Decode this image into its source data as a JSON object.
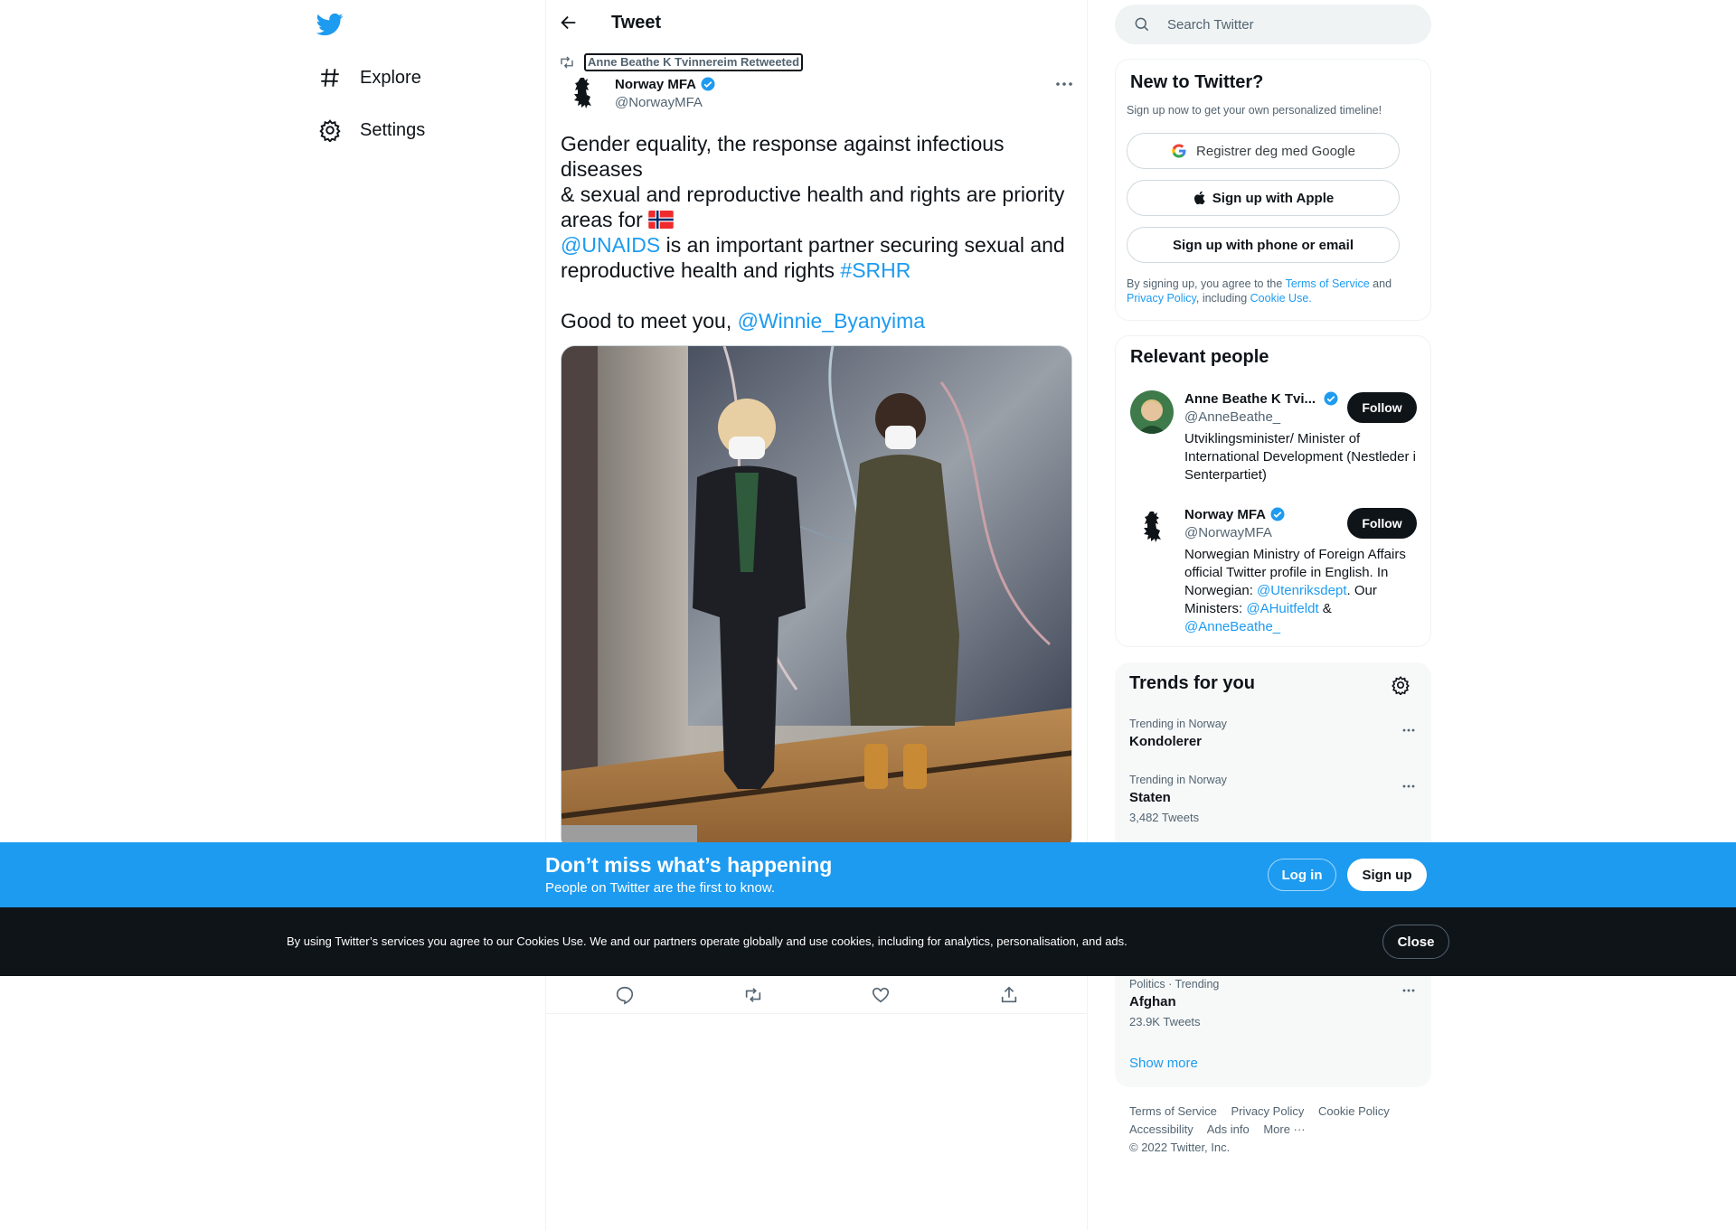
{
  "nav": {
    "explore_label": "Explore",
    "settings_label": "Settings"
  },
  "header": {
    "title": "Tweet"
  },
  "tweet": {
    "retweeted_by": "Anne Beathe K Tvinnereim Retweeted",
    "author_name": "Norway MFA",
    "author_handle": "@NorwayMFA",
    "line1": "Gender equality, the response against infectious diseases",
    "line2": "& sexual and reproductive health and rights are priority areas for",
    "mention_unaids": "@UNAIDS",
    "line3": " is an important partner securing sexual and reproductive health and rights",
    "hashtag": "#SRHR",
    "line4": "Good to meet you,",
    "mention_winnie": "@Winnie_Byanyima"
  },
  "search": {
    "placeholder": "Search Twitter"
  },
  "new_to_twitter": {
    "title": "New to Twitter?",
    "subtitle": "Sign up now to get your own personalized timeline!",
    "google_label": "Registrer deg med Google",
    "apple_label": "Sign up with Apple",
    "phone_label": "Sign up with phone or email",
    "terms_prefix": "By signing up, you agree to the",
    "terms_link": "Terms of Service",
    "terms_and": "and",
    "privacy_link": "Privacy Policy",
    "including": ", including",
    "cookie_link": "Cookie Use."
  },
  "relevant_people": {
    "title": "Relevant people",
    "people": [
      {
        "name": "Anne Beathe K Tvi...",
        "handle": "@AnneBeathe_",
        "bio": "Utviklingsminister/ Minister of International Development (Nestleder i Senterpartiet)",
        "follow_label": "Follow"
      },
      {
        "name": "Norway MFA",
        "handle": "@NorwayMFA",
        "bio_part1": "Norwegian Ministry of Foreign Affairs official Twitter profile in English. In Norwegian:",
        "bio_link1": "@Utenriksdept",
        "bio_part2": ". Our Ministers:",
        "bio_link2": "@AHuitfeldt",
        "bio_part3": " &",
        "bio_link3": "@AnneBeathe_",
        "follow_label": "Follow"
      }
    ]
  },
  "trends": {
    "title": "Trends for you",
    "items": [
      {
        "meta": "Trending in Norway",
        "name": "Kondolerer",
        "count": ""
      },
      {
        "meta": "Trending in Norway",
        "name": "Staten",
        "count": "3,482 Tweets"
      },
      {
        "meta": "Politics · Trending",
        "name": "Afghan",
        "count": "23.9K Tweets"
      }
    ],
    "show_more": "Show more"
  },
  "footer": {
    "links": [
      "Terms of Service",
      "Privacy Policy",
      "Cookie Policy",
      "Accessibility",
      "Ads info",
      "More ···"
    ],
    "copyright": "© 2022 Twitter, Inc."
  },
  "banner": {
    "title": "Don’t miss what’s happening",
    "subtitle": "People on Twitter are the first to know.",
    "login_label": "Log in",
    "signup_label": "Sign up"
  },
  "cookie": {
    "text": "By using Twitter’s services you agree to our Cookies Use. We and our partners operate globally and use cookies, including for analytics, personalisation, and ads.",
    "close_label": "Close"
  },
  "colors": {
    "brand": "#1d9bf0",
    "dark": "#0f1419",
    "muted": "#536471"
  }
}
